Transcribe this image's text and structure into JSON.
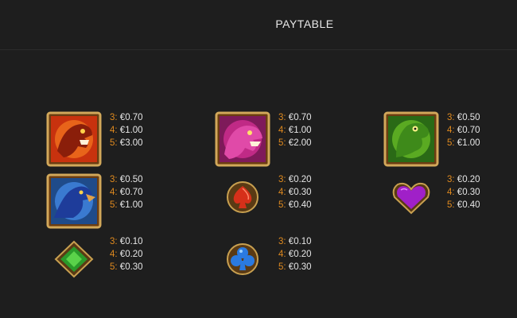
{
  "header": {
    "title": "PAYTABLE"
  },
  "symbols": [
    {
      "name": "red-dino-icon",
      "pays": [
        {
          "count": "3:",
          "value": "€0.70"
        },
        {
          "count": "4:",
          "value": "€1.00"
        },
        {
          "count": "5:",
          "value": "€3.00"
        }
      ]
    },
    {
      "name": "pink-dino-icon",
      "pays": [
        {
          "count": "3:",
          "value": "€0.70"
        },
        {
          "count": "4:",
          "value": "€1.00"
        },
        {
          "count": "5:",
          "value": "€2.00"
        }
      ]
    },
    {
      "name": "green-dino-icon",
      "pays": [
        {
          "count": "3:",
          "value": "€0.50"
        },
        {
          "count": "4:",
          "value": "€0.70"
        },
        {
          "count": "5:",
          "value": "€1.00"
        }
      ]
    },
    {
      "name": "blue-dino-icon",
      "pays": [
        {
          "count": "3:",
          "value": "€0.50"
        },
        {
          "count": "4:",
          "value": "€0.70"
        },
        {
          "count": "5:",
          "value": "€1.00"
        }
      ]
    },
    {
      "name": "spade-icon",
      "pays": [
        {
          "count": "3:",
          "value": "€0.20"
        },
        {
          "count": "4:",
          "value": "€0.30"
        },
        {
          "count": "5:",
          "value": "€0.40"
        }
      ]
    },
    {
      "name": "heart-icon",
      "pays": [
        {
          "count": "3:",
          "value": "€0.20"
        },
        {
          "count": "4:",
          "value": "€0.30"
        },
        {
          "count": "5:",
          "value": "€0.40"
        }
      ]
    },
    {
      "name": "diamond-icon",
      "pays": [
        {
          "count": "3:",
          "value": "€0.10"
        },
        {
          "count": "4:",
          "value": "€0.20"
        },
        {
          "count": "5:",
          "value": "€0.30"
        }
      ]
    },
    {
      "name": "club-icon",
      "pays": [
        {
          "count": "3:",
          "value": "€0.10"
        },
        {
          "count": "4:",
          "value": "€0.20"
        },
        {
          "count": "5:",
          "value": "€0.30"
        }
      ]
    }
  ],
  "colors": {
    "background": "#1e1e1e",
    "pay_count": "#e08a1e",
    "pay_value": "#e6e6e6"
  }
}
